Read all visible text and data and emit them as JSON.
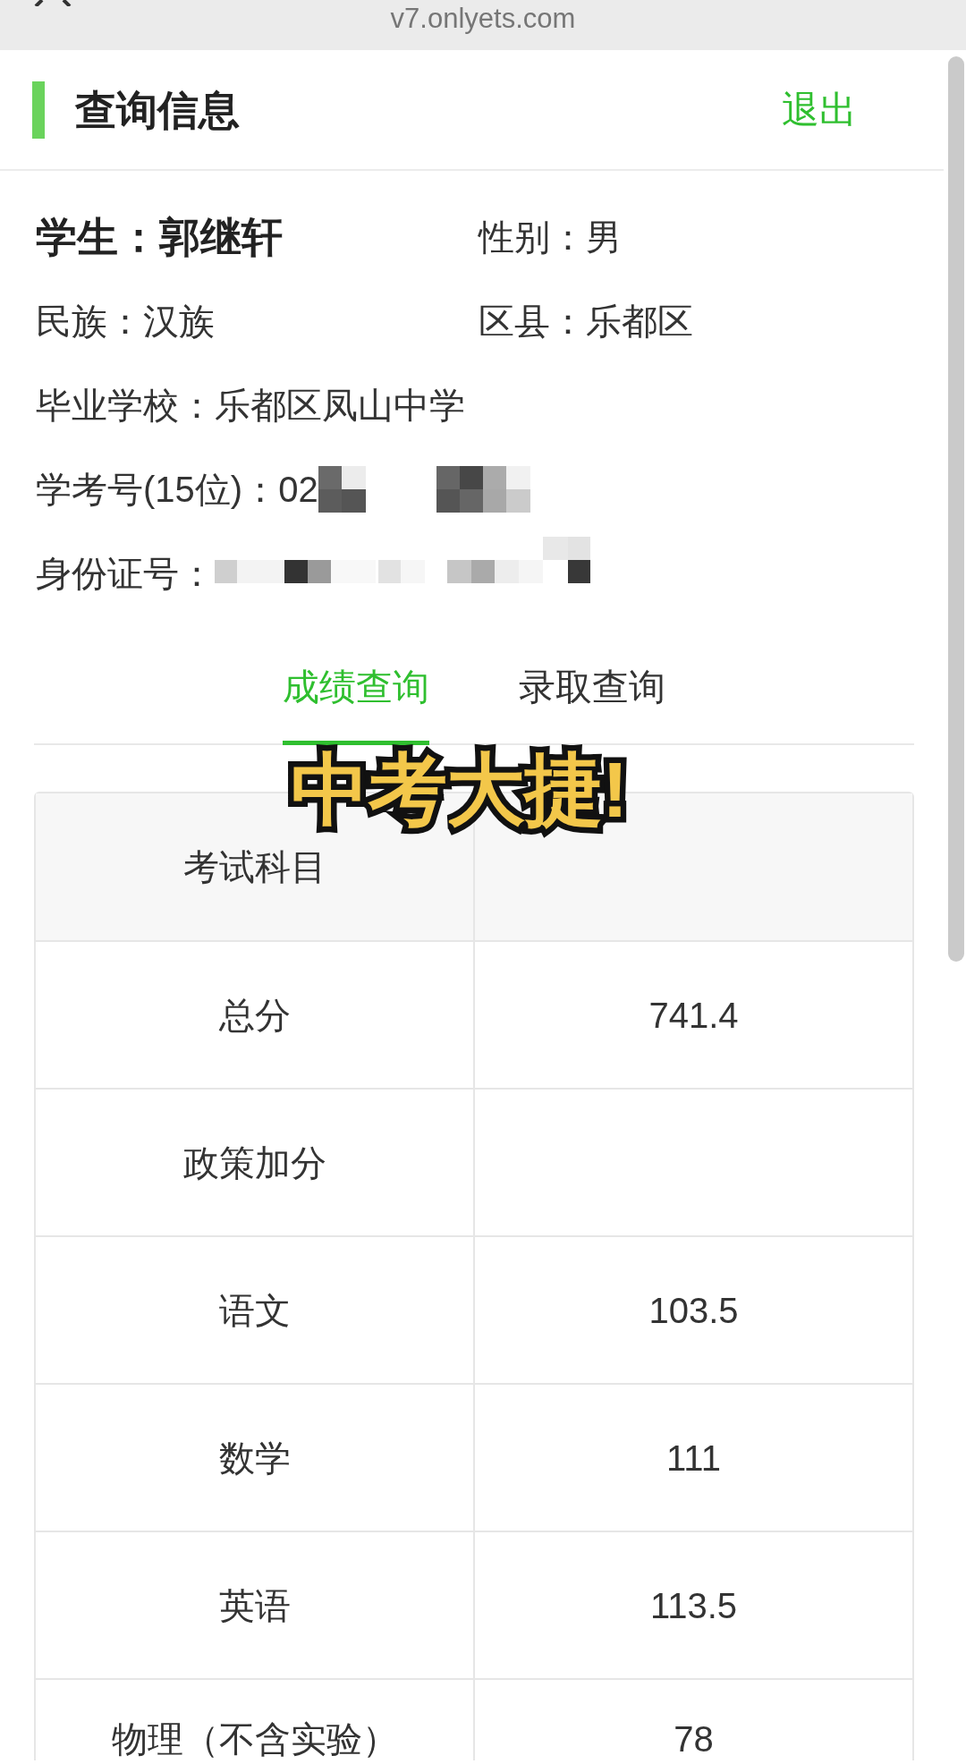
{
  "browser_bar": {
    "url": "v7.onlyets.com"
  },
  "header": {
    "title": "查询信息",
    "logout": "退出"
  },
  "info_rows": [
    [
      {
        "kind": "name",
        "label": "学生：",
        "value": "郭继轩"
      },
      {
        "kind": "field",
        "label": "性别：",
        "value": "男"
      }
    ],
    [
      {
        "kind": "field",
        "label": "民族：",
        "value": "汉族"
      },
      {
        "kind": "field",
        "label": "区县：",
        "value": "乐都区"
      }
    ],
    [
      {
        "kind": "field",
        "label": "毕业学校：",
        "value": "乐都区凤山中学"
      }
    ],
    [
      {
        "kind": "field",
        "label": "学考号(15位)：",
        "value": "02",
        "redacted": true
      }
    ],
    [
      {
        "kind": "field",
        "label": "身份证号：",
        "redacted": true
      }
    ]
  ],
  "tabs": [
    {
      "label": "成绩查询",
      "selected": true
    },
    {
      "label": "录取查询",
      "selected": false
    }
  ],
  "table": {
    "column_1": "考试科目",
    "rows": [
      {
        "subject": "总分",
        "score": "741.4"
      },
      {
        "subject": "政策加分"
      },
      {
        "subject": "语文",
        "score": "103.5"
      },
      {
        "subject": "数学",
        "score": "111"
      },
      {
        "subject": "英语",
        "score": "113.5"
      },
      {
        "subject": "物理（不含实验）",
        "score": "78"
      }
    ]
  },
  "overlay_caption": "中考大捷!"
}
